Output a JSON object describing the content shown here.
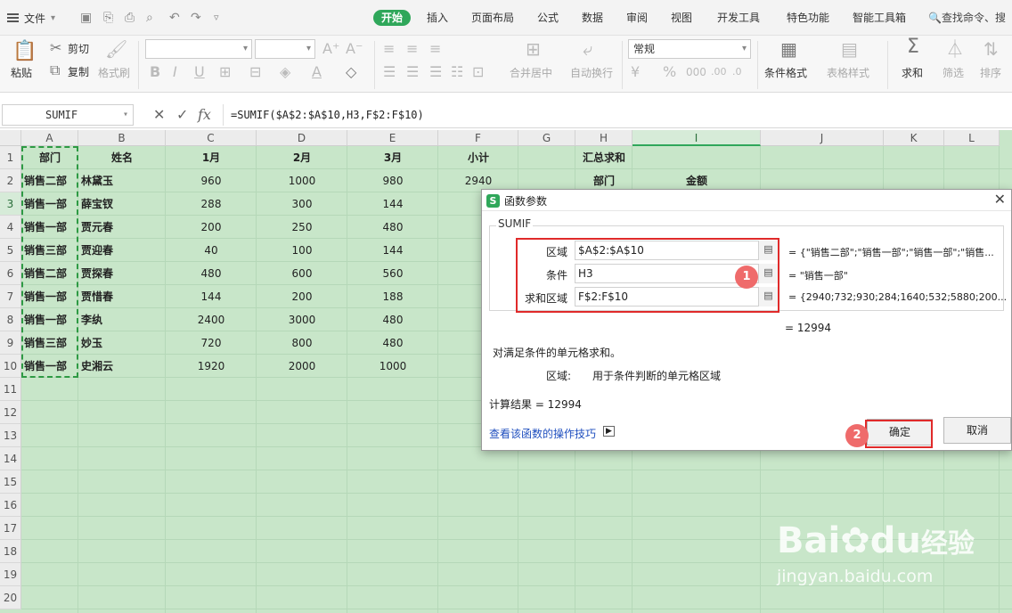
{
  "titlebar": {
    "file_label": "文件"
  },
  "menu": [
    "开始",
    "插入",
    "页面布局",
    "公式",
    "数据",
    "审阅",
    "视图",
    "开发工具",
    "特色功能",
    "智能工具箱"
  ],
  "menu_active": "开始",
  "search": {
    "placeholder": "查找命令、搜"
  },
  "ribbon": {
    "paste": "粘贴",
    "cut": "剪切",
    "copy": "复制",
    "format_painter": "格式刷",
    "merge_center": "合并居中",
    "wrap_text": "自动换行",
    "number_format": "常规",
    "conditional_format": "条件格式",
    "table_style": "表格样式",
    "sum": "求和",
    "filter": "筛选",
    "sort": "排序"
  },
  "formula_bar": {
    "name_box": "SUMIF",
    "fx": "fx",
    "formula": "=SUMIF($A$2:$A$10,H3,F$2:F$10)"
  },
  "columns": [
    "A",
    "B",
    "C",
    "D",
    "E",
    "F",
    "G",
    "H",
    "I",
    "J",
    "K",
    "L"
  ],
  "rows": [
    "1",
    "2",
    "3",
    "4",
    "5",
    "6",
    "7",
    "8",
    "9",
    "10",
    "11",
    "12",
    "13",
    "14",
    "15",
    "16",
    "17",
    "18",
    "19",
    "20"
  ],
  "header_row": {
    "dept": "部门",
    "name": "姓名",
    "m1": "1月",
    "m2": "2月",
    "m3": "3月",
    "subtotal": "小计",
    "summary": "汇总求和"
  },
  "data_rows": [
    [
      "销售二部",
      "林黛玉",
      "960",
      "1000",
      "980"
    ],
    [
      "销售一部",
      "薛宝钗",
      "288",
      "300",
      "144"
    ],
    [
      "销售一部",
      "贾元春",
      "200",
      "250",
      "480"
    ],
    [
      "销售三部",
      "贾迎春",
      "40",
      "100",
      "144"
    ],
    [
      "销售二部",
      "贾探春",
      "480",
      "600",
      "560"
    ],
    [
      "销售一部",
      "贾惜春",
      "144",
      "200",
      "188"
    ],
    [
      "销售一部",
      "李纨",
      "2400",
      "3000",
      "480"
    ],
    [
      "销售三部",
      "妙玉",
      "720",
      "800",
      "480"
    ],
    [
      "销售一部",
      "史湘云",
      "1920",
      "2000",
      "1000"
    ]
  ],
  "f2_value": "2940",
  "h2_label": "部门",
  "i2_label": "金额",
  "dialog": {
    "title": "函数参数",
    "function_name": "SUMIF",
    "args": [
      {
        "label": "区域",
        "value": "$A$2:$A$10",
        "result": "= {\"销售二部\";\"销售一部\";\"销售一部\";\"销售..."
      },
      {
        "label": "条件",
        "value": "H3",
        "result": "= \"销售一部\""
      },
      {
        "label": "求和区域",
        "value": "F$2:F$10",
        "result": "= {2940;732;930;284;1640;532;5880;200..."
      }
    ],
    "total_preview": "=   12994",
    "description": "对满足条件的单元格求和。",
    "arg_help_label": "区域:",
    "arg_help_text": "用于条件判断的单元格区域",
    "calc_result_label": "计算结果  =  12994",
    "help_link": "查看该函数的操作技巧",
    "ok": "确定",
    "cancel": "取消"
  },
  "annotations": {
    "badge1": "1",
    "badge2": "2"
  },
  "watermark": {
    "brand": "Bai",
    "brand2": "du",
    "cn": "经验",
    "url": "jingyan.baidu.com"
  }
}
